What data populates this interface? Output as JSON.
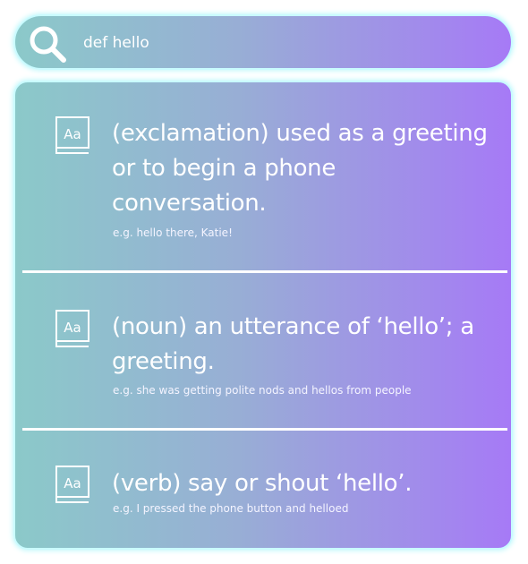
{
  "search": {
    "value": "def hello",
    "icon": "search-icon"
  },
  "theme": {
    "gradient_start": "#8bc9c9",
    "gradient_end": "#a67af6",
    "glow": "#c9fbff"
  },
  "results": [
    {
      "icon": "dictionary-icon",
      "definition": "(exclamation) used as a greeting or to begin a phone conversation.",
      "example": "e.g. hello there, Katie!"
    },
    {
      "icon": "dictionary-icon",
      "definition": "(noun) an utterance of ‘hello’; a greeting.",
      "example": "e.g. she was getting polite nods and hellos from people"
    },
    {
      "icon": "dictionary-icon",
      "definition": "(verb) say or shout ‘hello’.",
      "example": "e.g. I pressed the phone button and helloed"
    }
  ]
}
